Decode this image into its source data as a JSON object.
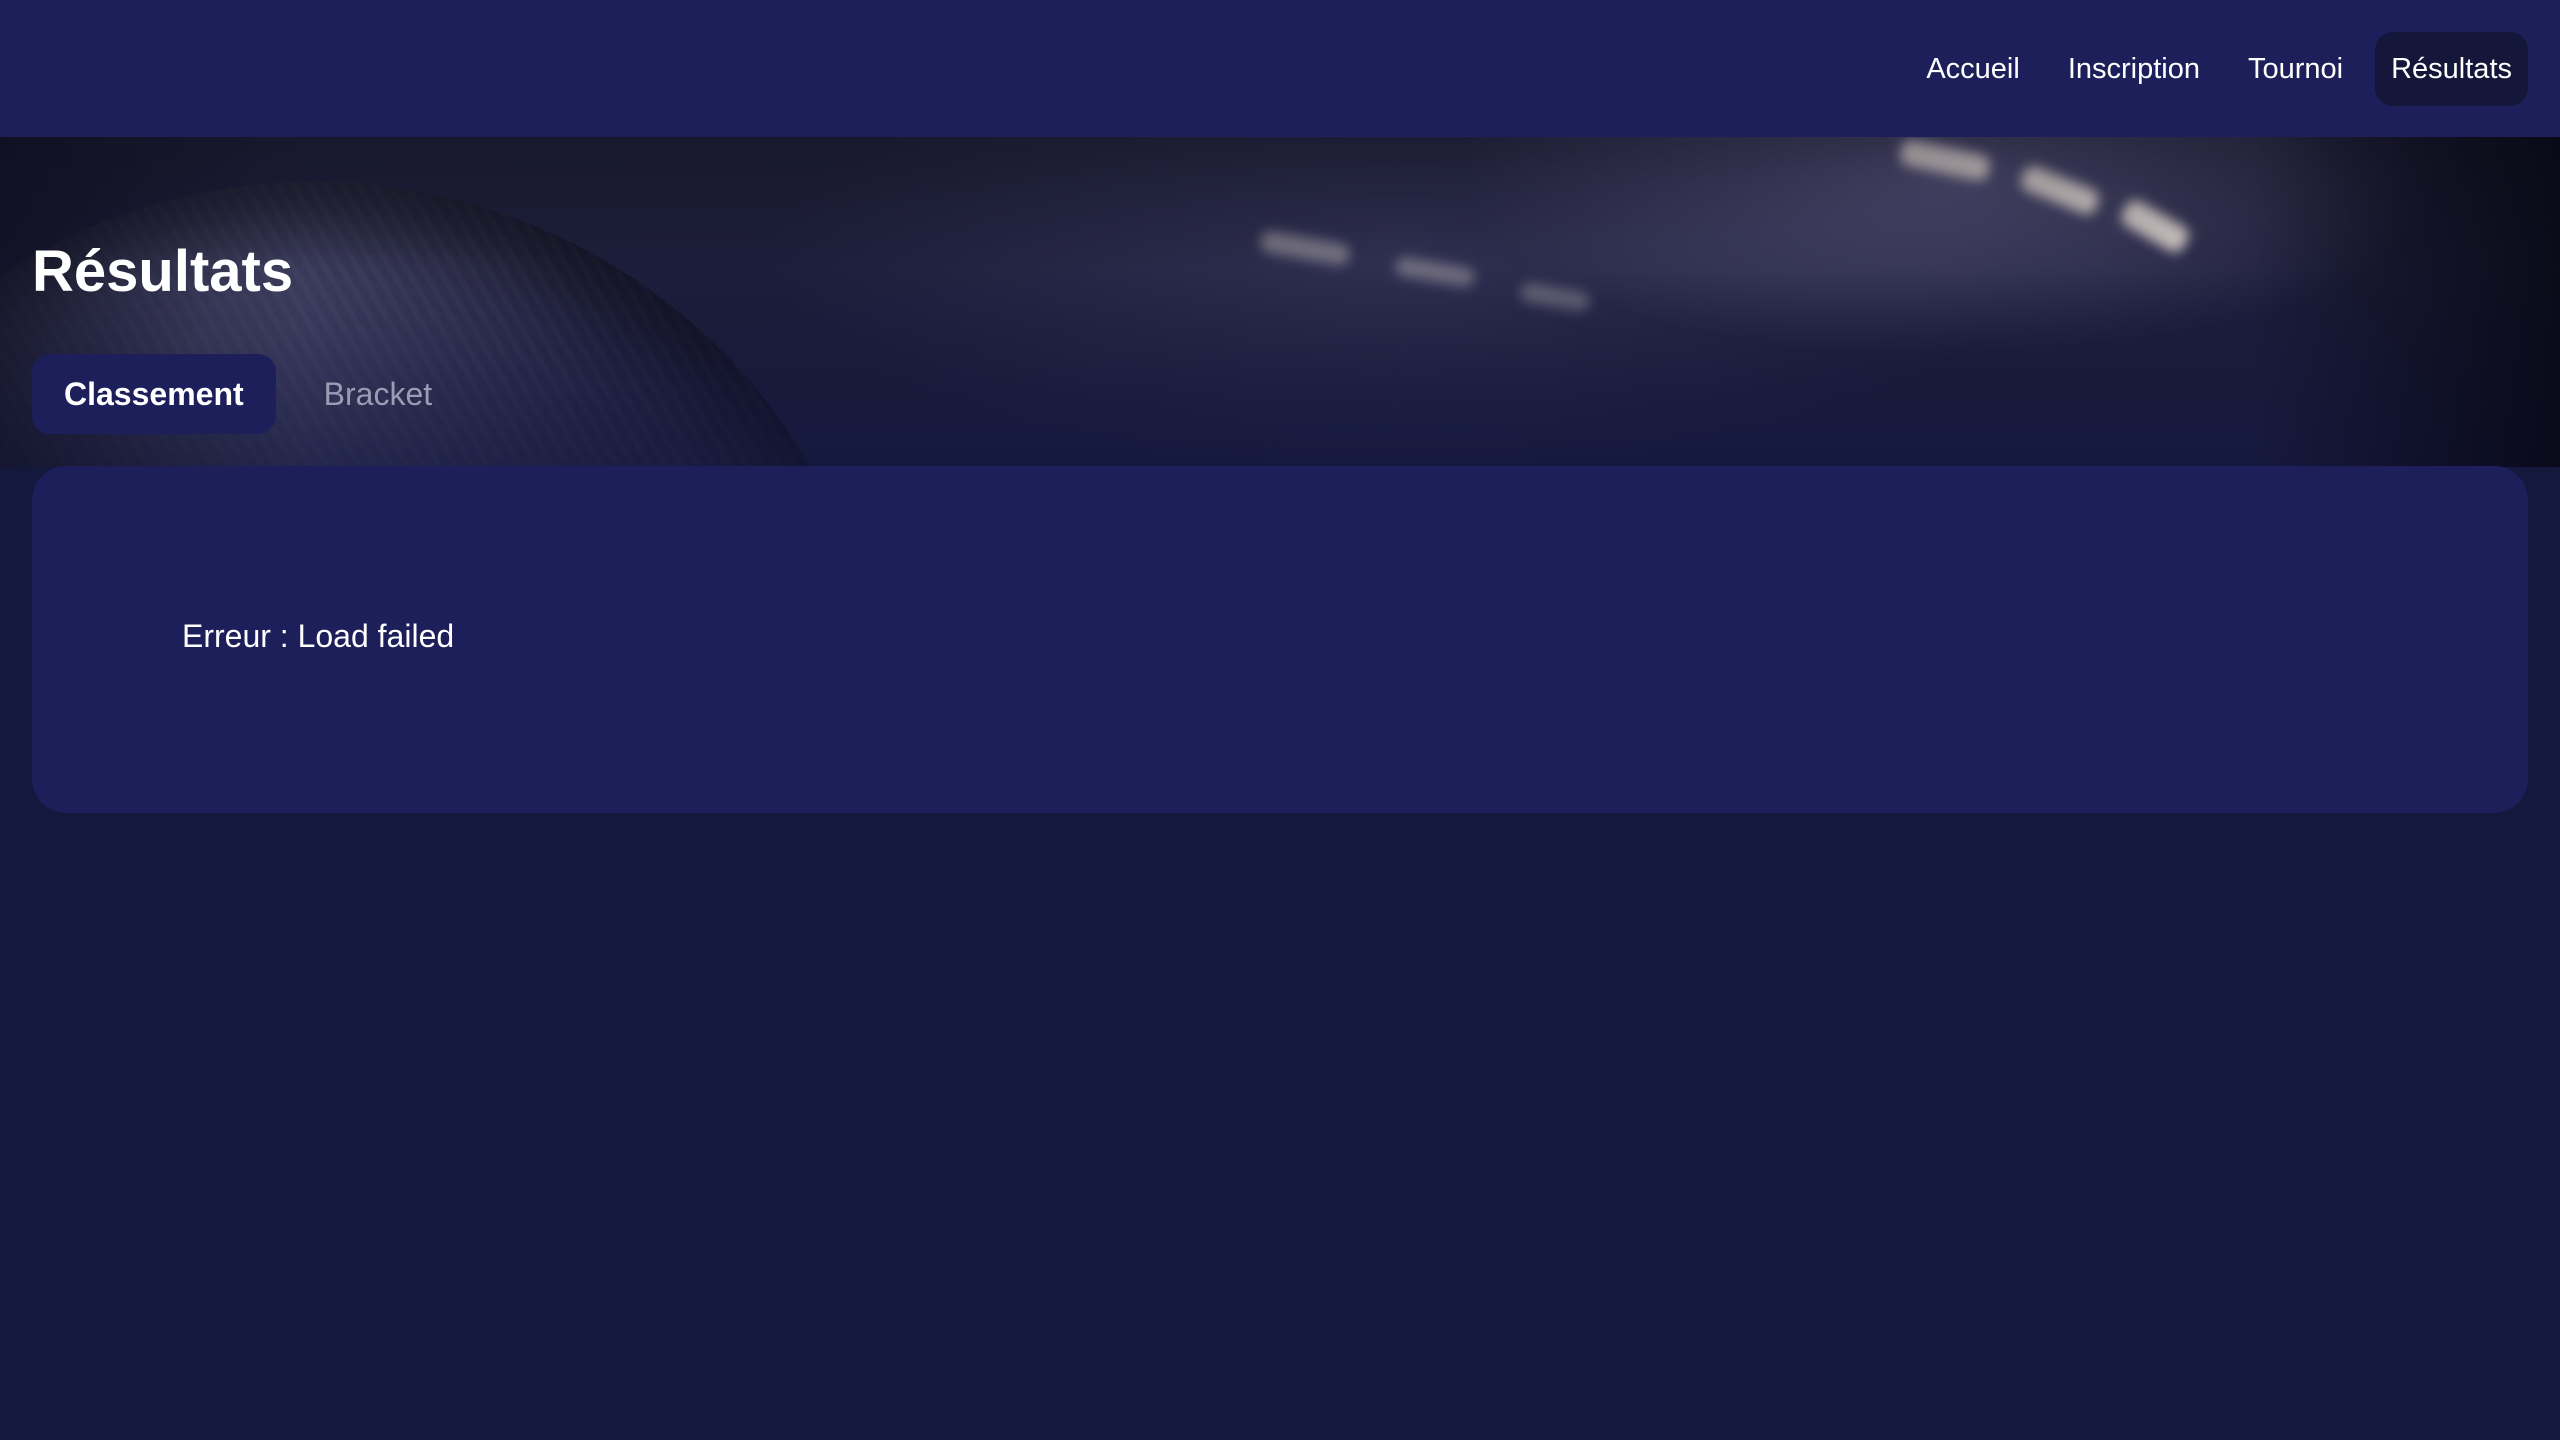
{
  "nav": {
    "items": [
      {
        "label": "Accueil",
        "active": false
      },
      {
        "label": "Inscription",
        "active": false
      },
      {
        "label": "Tournoi",
        "active": false
      },
      {
        "label": "Résultats",
        "active": true
      }
    ]
  },
  "page": {
    "title": "Résultats"
  },
  "tabs": [
    {
      "label": "Classement",
      "active": true
    },
    {
      "label": "Bracket",
      "active": false
    }
  ],
  "content": {
    "error_message": "Erreur : Load failed"
  },
  "colors": {
    "background": "#15183d",
    "surface": "#1d1f5b",
    "nav_active": "#14163a",
    "text": "#ffffff",
    "text_muted": "#9a9cb4"
  }
}
